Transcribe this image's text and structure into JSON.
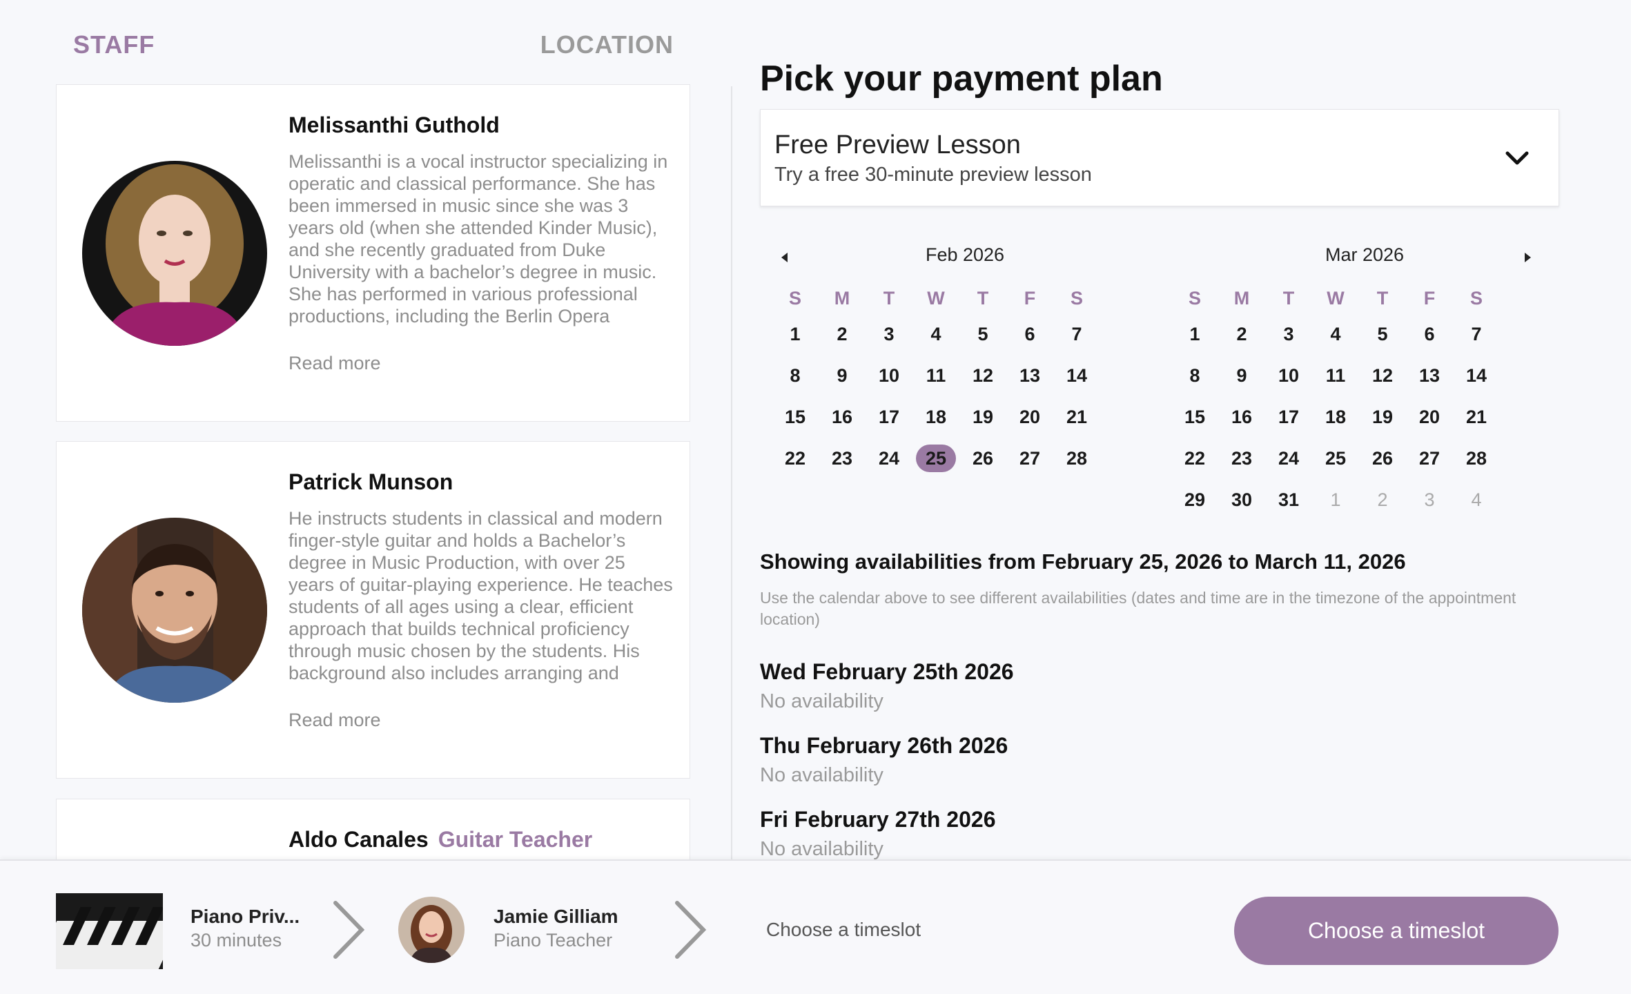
{
  "tabs": {
    "staff": "STAFF",
    "location": "LOCATION"
  },
  "staff": [
    {
      "name": "Melissanthi Guthold",
      "role": "",
      "bio": "Melissanthi is a vocal instructor specializing in operatic and classical performance. She has been immersed in music since she was 3 years old (when she attended Kinder Music), and she recently graduated from Duke University with a bachelor’s degree in music. She has performed in various professional productions, including the Berlin Opera",
      "read_more": "Read more"
    },
    {
      "name": "Patrick Munson",
      "role": "",
      "bio": "He instructs students in classical and modern finger-style guitar and holds a Bachelor’s degree in Music Production, with over 25 years of guitar-playing experience. He teaches students of all ages using a clear, efficient approach that builds technical proficiency through music chosen by the students. His background also includes arranging and",
      "read_more": "Read more"
    },
    {
      "name": "Aldo Canales",
      "role": "Guitar Teacher"
    }
  ],
  "plan": {
    "title": "Pick your payment plan",
    "selected_name": "Free Preview Lesson",
    "selected_desc": "Try a free 30-minute preview lesson"
  },
  "calendar": {
    "weekdays": [
      "S",
      "M",
      "T",
      "W",
      "T",
      "F",
      "S"
    ],
    "months": [
      {
        "title": "Feb 2026",
        "weeks": [
          [
            "1",
            "2",
            "3",
            "4",
            "5",
            "6",
            "7"
          ],
          [
            "8",
            "9",
            "10",
            "11",
            "12",
            "13",
            "14"
          ],
          [
            "15",
            "16",
            "17",
            "18",
            "19",
            "20",
            "21"
          ],
          [
            "22",
            "23",
            "24",
            "25",
            "26",
            "27",
            "28"
          ]
        ],
        "selected": "25",
        "other_month_start_week": 99,
        "other_month_start_col": 99
      },
      {
        "title": "Mar 2026",
        "weeks": [
          [
            "1",
            "2",
            "3",
            "4",
            "5",
            "6",
            "7"
          ],
          [
            "8",
            "9",
            "10",
            "11",
            "12",
            "13",
            "14"
          ],
          [
            "15",
            "16",
            "17",
            "18",
            "19",
            "20",
            "21"
          ],
          [
            "22",
            "23",
            "24",
            "25",
            "26",
            "27",
            "28"
          ],
          [
            "29",
            "30",
            "31",
            "1",
            "2",
            "3",
            "4"
          ]
        ],
        "selected": "",
        "other_month_start_week": 4,
        "other_month_start_col": 3
      }
    ]
  },
  "availability": {
    "heading": "Showing availabilities from February 25, 2026 to March 11, 2026",
    "note": "Use the calendar above to see different availabilities (dates and time are in the timezone of the appointment location)",
    "days": [
      {
        "title": "Wed February 25th 2026",
        "status": "No availability"
      },
      {
        "title": "Thu February 26th 2026",
        "status": "No availability"
      },
      {
        "title": "Fri February 27th 2026",
        "status": "No availability"
      }
    ]
  },
  "bottom": {
    "service_name": "Piano Priv...",
    "service_duration": "30 minutes",
    "teacher_name": "Jamie Gilliam",
    "teacher_role": "Piano Teacher",
    "step_label": "Choose a timeslot",
    "cta_label": "Choose a timeslot"
  },
  "colors": {
    "accent": "#9a7aa3",
    "muted": "#8d8d8d"
  }
}
